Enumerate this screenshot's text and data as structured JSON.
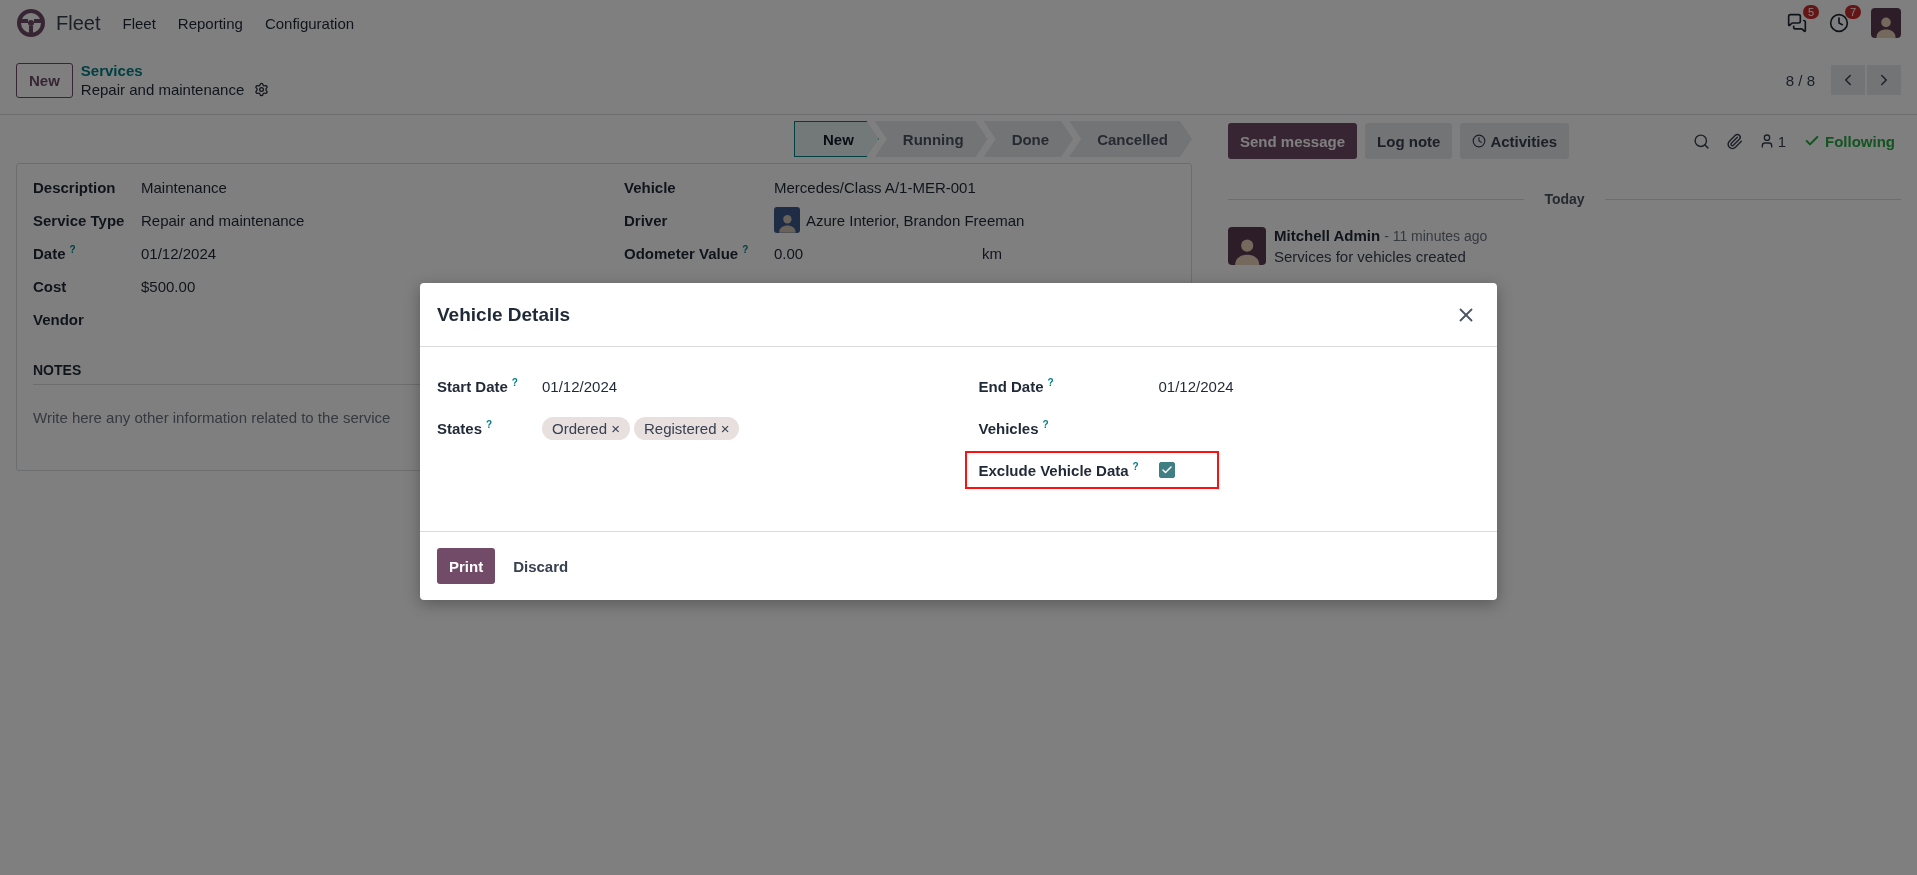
{
  "navbar": {
    "app_name": "Fleet",
    "menus": [
      "Fleet",
      "Reporting",
      "Configuration"
    ],
    "messages_badge": "5",
    "activities_badge": "7"
  },
  "control_panel": {
    "new_button": "New",
    "breadcrumb": "Services",
    "record_title": "Repair and maintenance",
    "pager": "8 / 8"
  },
  "statusbar": [
    {
      "label": "New",
      "selected": true
    },
    {
      "label": "Running",
      "selected": false
    },
    {
      "label": "Done",
      "selected": false
    },
    {
      "label": "Cancelled",
      "selected": false
    }
  ],
  "form": {
    "left_fields": [
      {
        "label": "Description",
        "value": "Maintenance"
      },
      {
        "label": "Service Type",
        "value": "Repair and maintenance"
      },
      {
        "label": "Date",
        "help": "?",
        "value": "01/12/2024"
      },
      {
        "label": "Cost",
        "value": "$500.00"
      },
      {
        "label": "Vendor"
      }
    ],
    "right_fields": [
      {
        "kind": "text",
        "label": "Vehicle",
        "value": "Mercedes/Class A/1-MER-001"
      },
      {
        "kind": "avatar",
        "label": "Driver",
        "value": "Azure Interior, Brandon Freeman"
      },
      {
        "kind": "unit",
        "label": "Odometer Value",
        "help": "?",
        "value": "0.00",
        "unit": "km"
      }
    ],
    "notes": {
      "heading": "NOTES",
      "placeholder": "Write here any other information related to the service"
    }
  },
  "chatter": {
    "buttons": [
      {
        "label": "Send message",
        "kind": "primary"
      },
      {
        "label": "Log note",
        "kind": "plain"
      },
      {
        "label": "Activities",
        "kind": "activities"
      }
    ],
    "followers": "1",
    "following": "Following",
    "date": "Today",
    "message": {
      "author": "Mitchell Admin",
      "time": "- 11 minutes ago",
      "body": "Services for vehicles created"
    }
  },
  "modal": {
    "title": "Vehicle Details",
    "left_fields": [
      {
        "kind": "text",
        "label": "Start Date",
        "help": "?",
        "value": "01/12/2024"
      },
      {
        "kind": "tags",
        "label": "States",
        "help": "?",
        "tags": [
          {
            "label": "Ordered",
            "remove": "×"
          },
          {
            "label": "Registered",
            "remove": "×"
          }
        ]
      }
    ],
    "right_fields": [
      {
        "kind": "text",
        "label": "End Date",
        "help": "?",
        "value": "01/12/2024",
        "highlighted": false
      },
      {
        "kind": "empty",
        "label": "Vehicles",
        "help": "?",
        "highlighted": false
      },
      {
        "kind": "checkbox",
        "label": "Exclude Vehicle Data",
        "help": "?",
        "checked": true,
        "highlighted": true
      }
    ],
    "buttons": [
      {
        "label": "Print",
        "kind": "primary"
      },
      {
        "label": "Discard",
        "kind": "plain"
      }
    ]
  }
}
